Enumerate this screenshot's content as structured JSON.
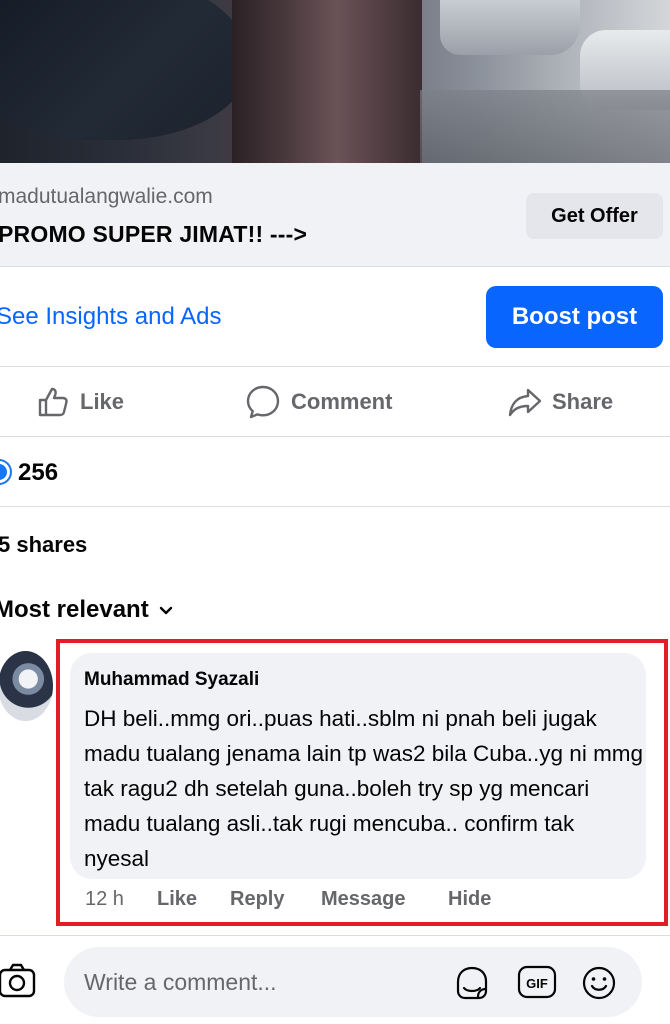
{
  "link_preview": {
    "domain": "madutualangwalie.com",
    "title": "PROMO SUPER JIMAT!! --->",
    "cta_label": "Get Offer"
  },
  "insights": {
    "link_label": "See Insights and Ads",
    "boost_label": "Boost post"
  },
  "actions": {
    "like": "Like",
    "comment": "Comment",
    "share": "Share"
  },
  "reactions": {
    "count": "256"
  },
  "shares_text": "5 shares",
  "sort_label": "Most relevant",
  "comment": {
    "author": "Muhammad Syazali",
    "text": "DH beli..mmg ori..puas hati..sblm ni pnah beli jugak madu tualang jenama lain tp was2 bila Cuba..yg ni mmg tak ragu2 dh setelah guna..boleh try sp yg mencari madu tualang asli..tak rugi mencuba.. confirm tak nyesal",
    "time": "12 h",
    "like": "Like",
    "reply": "Reply",
    "message": "Message",
    "hide": "Hide"
  },
  "composer": {
    "placeholder": "Write a comment..."
  },
  "colors": {
    "accent": "#0866ff",
    "highlight": "#e21d25",
    "secondary_text": "#65676b",
    "bubble": "#f0f2f5"
  }
}
